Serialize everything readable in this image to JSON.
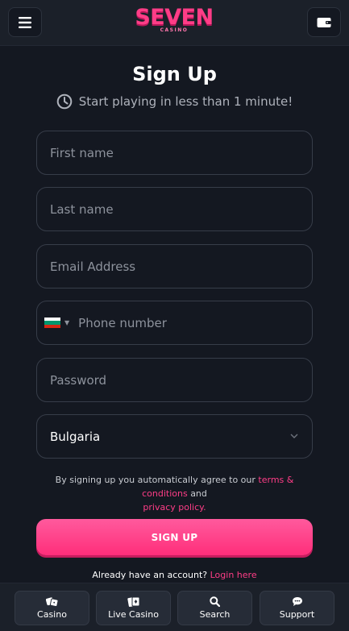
{
  "header": {
    "logo_text": "SEVEN",
    "logo_sub": "CASINO",
    "menu_icon": "hamburger-menu-icon",
    "wallet_icon": "wallet-icon"
  },
  "form": {
    "title": "Sign Up",
    "subtitle": "Start playing in less than 1 minute!",
    "first_name_placeholder": "First name",
    "last_name_placeholder": "Last name",
    "email_placeholder": "Email Address",
    "phone_placeholder": "Phone number",
    "phone_flag_country": "Bulgaria",
    "password_placeholder": "Password",
    "country_value": "Bulgaria",
    "terms_prefix": "By signing up you automatically agree to our",
    "terms_link": "terms & conditions",
    "terms_and": "and",
    "privacy_link": "privacy policy.",
    "signup_button": "SIGN UP",
    "already_text": "Already have an account?",
    "login_link": "Login here"
  },
  "bottom_nav": [
    {
      "label": "Casino",
      "icon": "dice-icon"
    },
    {
      "label": "Live Casino",
      "icon": "live-cards-icon"
    },
    {
      "label": "Search",
      "icon": "search-icon"
    },
    {
      "label": "Support",
      "icon": "chat-bubble-icon"
    }
  ],
  "colors": {
    "accent": "#ff3d87",
    "background": "#141821",
    "header_bg": "#1b2029"
  }
}
